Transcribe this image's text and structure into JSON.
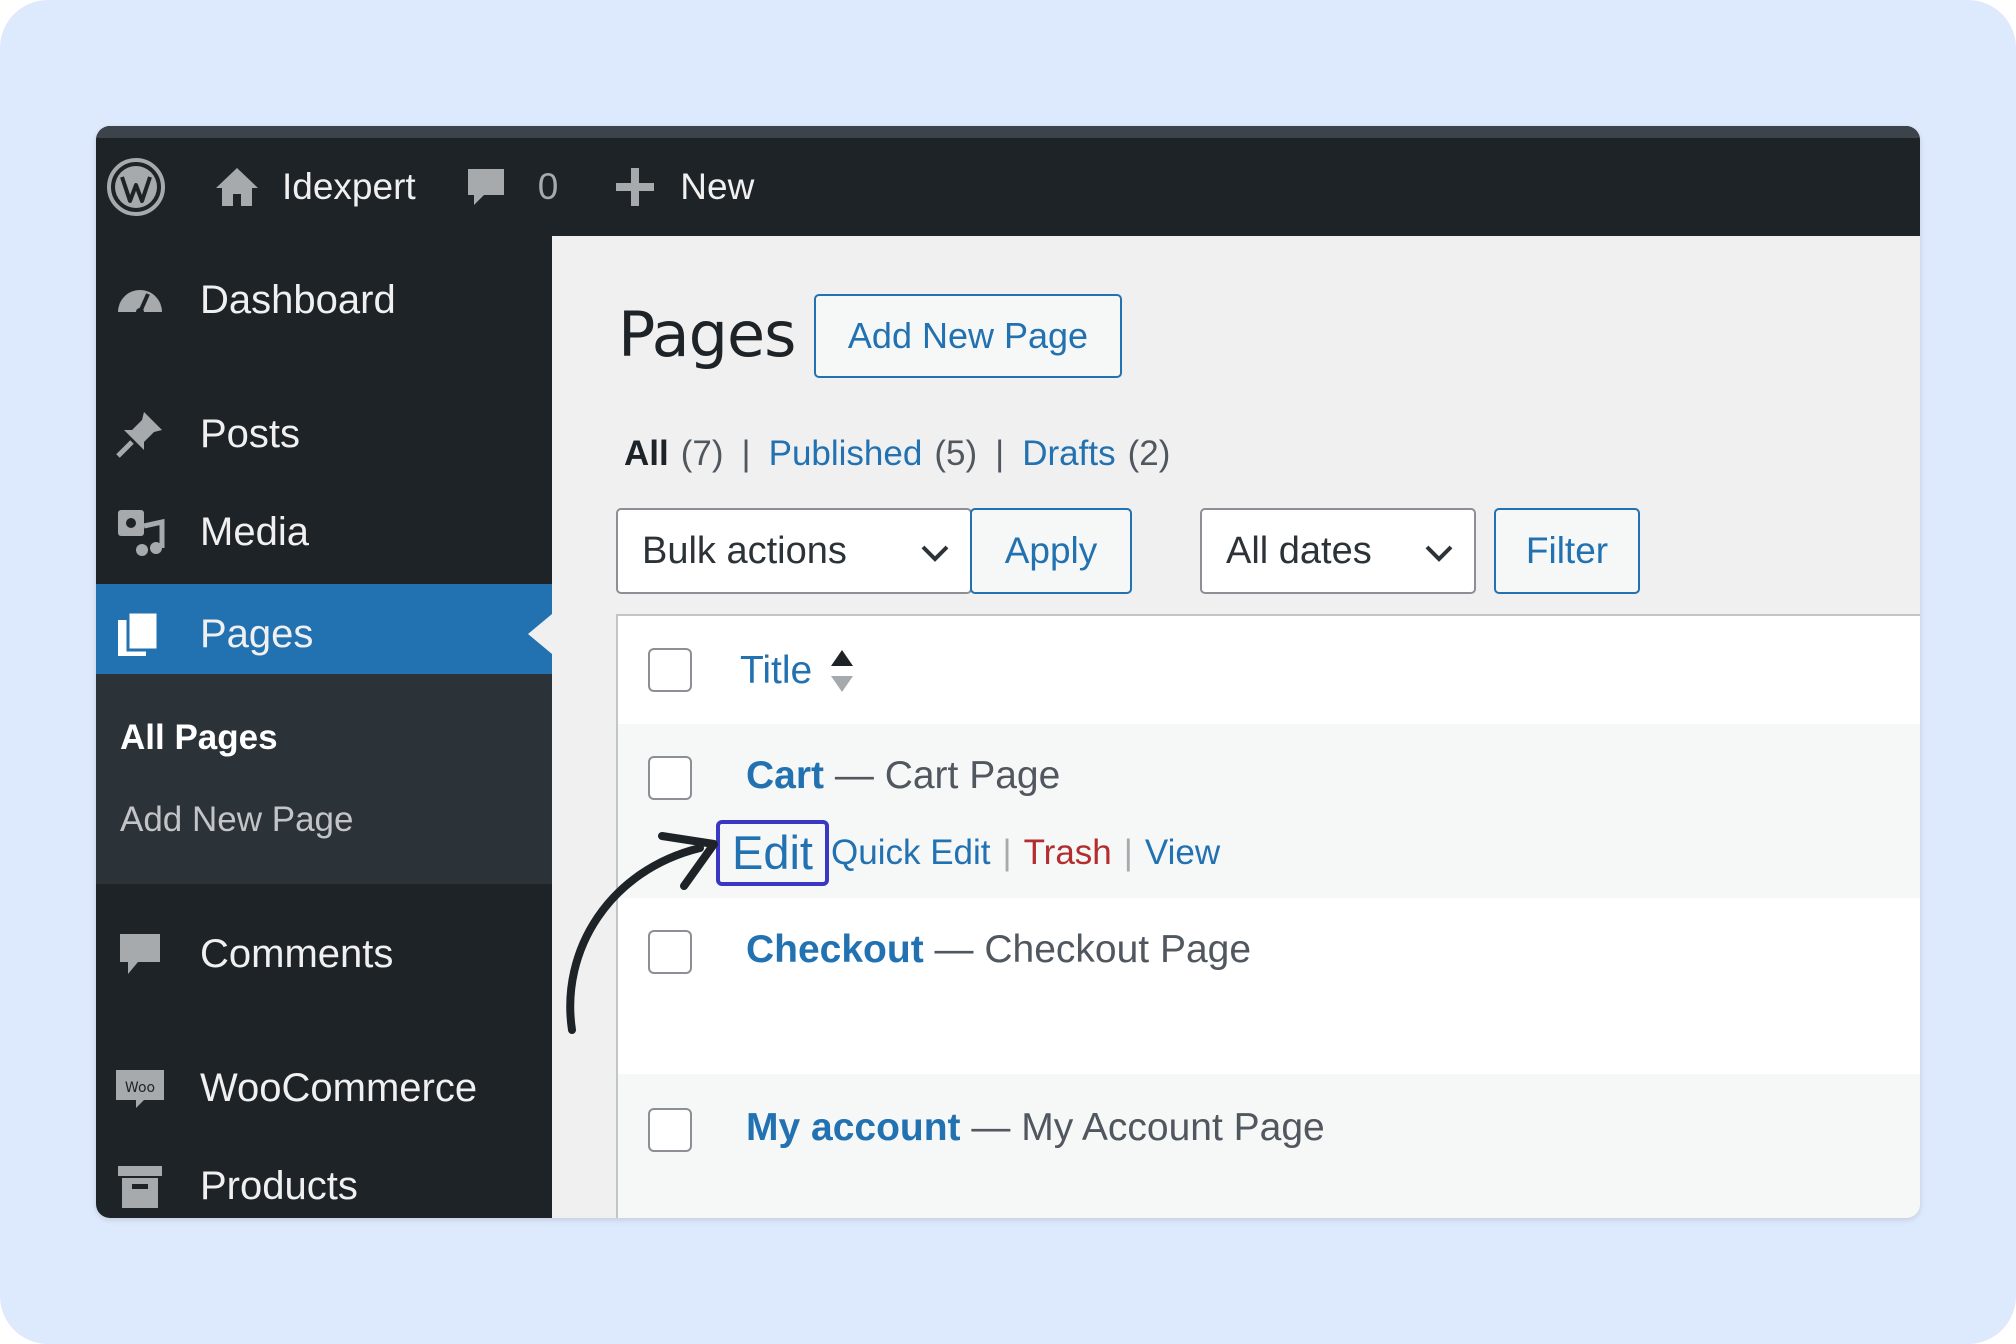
{
  "adminbar": {
    "site_name": "Idexpert",
    "comments_count": "0",
    "new_label": "New"
  },
  "sidebar": {
    "items": [
      {
        "label": "Dashboard",
        "icon": "dashboard-icon"
      },
      {
        "label": "Posts",
        "icon": "pin-icon"
      },
      {
        "label": "Media",
        "icon": "media-icon"
      },
      {
        "label": "Pages",
        "icon": "pages-icon",
        "current": true
      },
      {
        "label": "Comments",
        "icon": "comment-icon"
      },
      {
        "label": "WooCommerce",
        "icon": "woo-icon"
      },
      {
        "label": "Products",
        "icon": "archive-icon"
      }
    ],
    "submenu": [
      {
        "label": "All Pages",
        "current": true
      },
      {
        "label": "Add New Page"
      }
    ]
  },
  "main": {
    "title": "Pages",
    "add_new_label": "Add New Page",
    "views": [
      {
        "label": "All",
        "count": "(7)"
      },
      {
        "label": "Published",
        "count": "(5)"
      },
      {
        "label": "Drafts",
        "count": "(2)"
      }
    ],
    "views_separator": "|",
    "bulk_actions": "Bulk actions",
    "apply_label": "Apply",
    "dates_filter": "All dates",
    "filter_label": "Filter",
    "table": {
      "column_title": "Title",
      "rows": [
        {
          "title": "Cart",
          "state": " — Cart Page"
        },
        {
          "title": "Checkout",
          "state": " — Checkout Page"
        },
        {
          "title": "My account",
          "state": " — My Account Page"
        }
      ],
      "row_actions": {
        "edit": "Edit",
        "quick_edit": "Quick Edit",
        "trash": "Trash",
        "view": "View",
        "separator": "|"
      }
    }
  },
  "colors": {
    "admin_dark": "#1d2327",
    "accent_blue": "#2271b1",
    "trash_red": "#b32d2e",
    "highlight_box": "#3b37c5",
    "backdrop": "#dde9fc"
  }
}
